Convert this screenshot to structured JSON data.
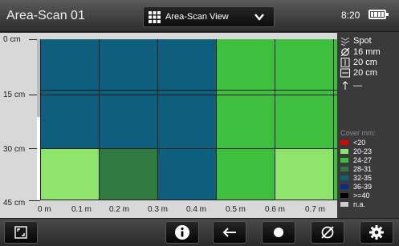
{
  "header": {
    "title": "Area-Scan 01",
    "view_label": "Area-Scan View",
    "time": "8:20"
  },
  "plot": {
    "y_labels": [
      "0 cm",
      "15 cm",
      "30 cm",
      "45 cm"
    ],
    "x_labels": [
      "0 m",
      "0.1 m",
      "0.2 m",
      "0.3 m",
      "0.4 m",
      "0.5 m",
      "0.6 m",
      "0.7 m"
    ],
    "cells": [
      [
        "#0e5f7e",
        "#0e5f7e",
        "#0e5f7e",
        "#3dbf3d",
        "#3dbf3d",
        "#3dbf3d"
      ],
      [
        "#0e5f7e",
        "#0e5f7e",
        "#0e5f7e",
        "#3dbf3d",
        "#3dbf3d",
        "#3dbf3d"
      ],
      [
        "#8ee36a",
        "#2f7a3e",
        "#0e5f7e",
        "#3dbf3d",
        "#8ee36a",
        "#3dbf3d"
      ]
    ]
  },
  "params": {
    "mode": "Spot",
    "diameter": "16 mm",
    "vertical": "20 cm",
    "horizontal": "20 cm",
    "direction": "—"
  },
  "legend": {
    "title": "Cover mm:",
    "items": [
      {
        "label": "<20",
        "color": "#e00000"
      },
      {
        "label": "20-23",
        "color": "#8ee36a"
      },
      {
        "label": "24-27",
        "color": "#3dbf3d"
      },
      {
        "label": "28-31",
        "color": "#2f7a3e"
      },
      {
        "label": "32-35",
        "color": "#0e5f7e"
      },
      {
        "label": "36-39",
        "color": "#0a2a8c"
      },
      {
        "label": ">=40",
        "color": "#000000"
      },
      {
        "label": "n.a.",
        "color": "#cccccc"
      }
    ]
  },
  "toolbar": {
    "buttons": [
      "fullscreen-icon",
      "info-icon",
      "back-arrow-icon",
      "record-icon",
      "diameter-icon",
      "settings-gear-icon"
    ]
  }
}
